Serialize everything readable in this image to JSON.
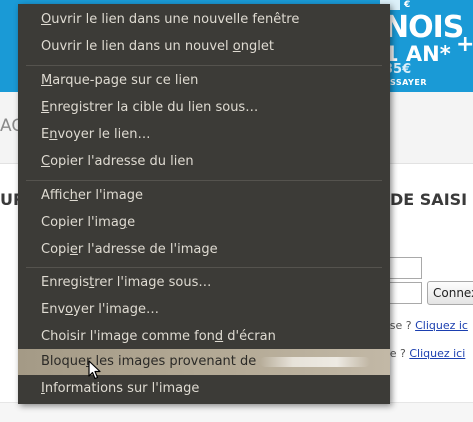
{
  "banner": {
    "line1": "NOIS",
    "line2": "1 AN*",
    "line3": "35€",
    "line4": "ESSAYER",
    "plus": "+",
    "corner": "€"
  },
  "page": {
    "nav_fragment": "AC",
    "heading_left": "UR",
    "heading_right": "DE SAISI",
    "connect_button": "Connex",
    "help_line1_prefix": "sse ?",
    "help_line1_link": "Cliquez ic",
    "help_line2_prefix": "se ?",
    "help_line2_link": "Cliquez ici"
  },
  "context_menu": {
    "items": [
      {
        "pre": "",
        "acc": "O",
        "post": "uvrir le lien dans une nouvelle fenêtre"
      },
      {
        "pre": "Ouvrir le lien dans un nouvel ",
        "acc": "o",
        "post": "nglet"
      },
      {
        "pre": "",
        "acc": "M",
        "post": "arque-page sur ce lien"
      },
      {
        "pre": "",
        "acc": "E",
        "post": "nregistrer la cible du lien sous…"
      },
      {
        "pre": "E",
        "acc": "n",
        "post": "voyer le lien…"
      },
      {
        "pre": "",
        "acc": "C",
        "post": "opier l'adresse du lien"
      },
      {
        "pre": "Affic",
        "acc": "h",
        "post": "er l'image"
      },
      {
        "pre": "Copier l'ima",
        "acc": "g",
        "post": "e"
      },
      {
        "pre": "Copi",
        "acc": "e",
        "post": "r l'adresse de l'image"
      },
      {
        "pre": "Enregis",
        "acc": "t",
        "post": "rer l'image sous…"
      },
      {
        "pre": "Env",
        "acc": "o",
        "post": "yer l'image…"
      },
      {
        "pre": "Choisir l'image comme fon",
        "acc": "d",
        "post": " d'écran"
      },
      {
        "pre": "Bloque",
        "acc": "r",
        "post": " les images provenant de"
      },
      {
        "pre": "",
        "acc": "I",
        "post": "nformations sur l'image"
      }
    ]
  },
  "colors": {
    "menu_bg": "#3c3b37",
    "menu_text": "#dfdbd2",
    "highlight": "#b5ab97",
    "banner": "#1a9ad6",
    "link": "#1b3fb0"
  }
}
